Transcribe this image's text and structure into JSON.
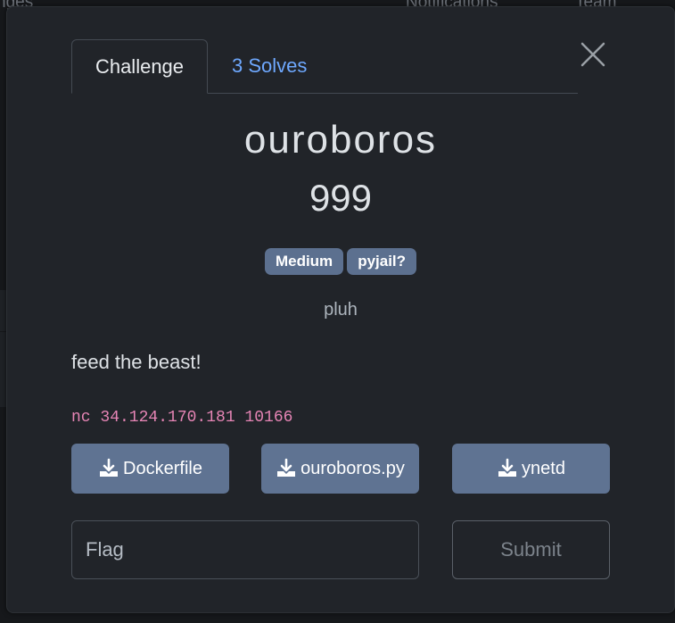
{
  "background": {
    "nav_left": "nges",
    "notifications": "Notifications",
    "team": "Team"
  },
  "modal": {
    "tabs": [
      {
        "label": "Challenge",
        "active": true
      },
      {
        "label": "3 Solves",
        "active": false
      }
    ],
    "close_icon": "close-icon"
  },
  "challenge": {
    "name": "ouroboros",
    "points": "999",
    "tags": [
      "Medium",
      "pyjail?"
    ],
    "author": "pluh",
    "description": "feed the beast!",
    "connection": "nc 34.124.170.181 10166"
  },
  "files": [
    {
      "label": "Dockerfile",
      "icon": "download-icon"
    },
    {
      "label": "ouroboros.py",
      "icon": "download-icon"
    },
    {
      "label": "ynetd",
      "icon": "download-icon"
    }
  ],
  "submission": {
    "placeholder": "Flag",
    "submit_label": "Submit"
  },
  "colors": {
    "accent": "#6ea8fe",
    "tag_bg": "#5c708f",
    "button_bg": "#5f7392",
    "connection_text": "#e685b5",
    "modal_bg": "#212429"
  }
}
